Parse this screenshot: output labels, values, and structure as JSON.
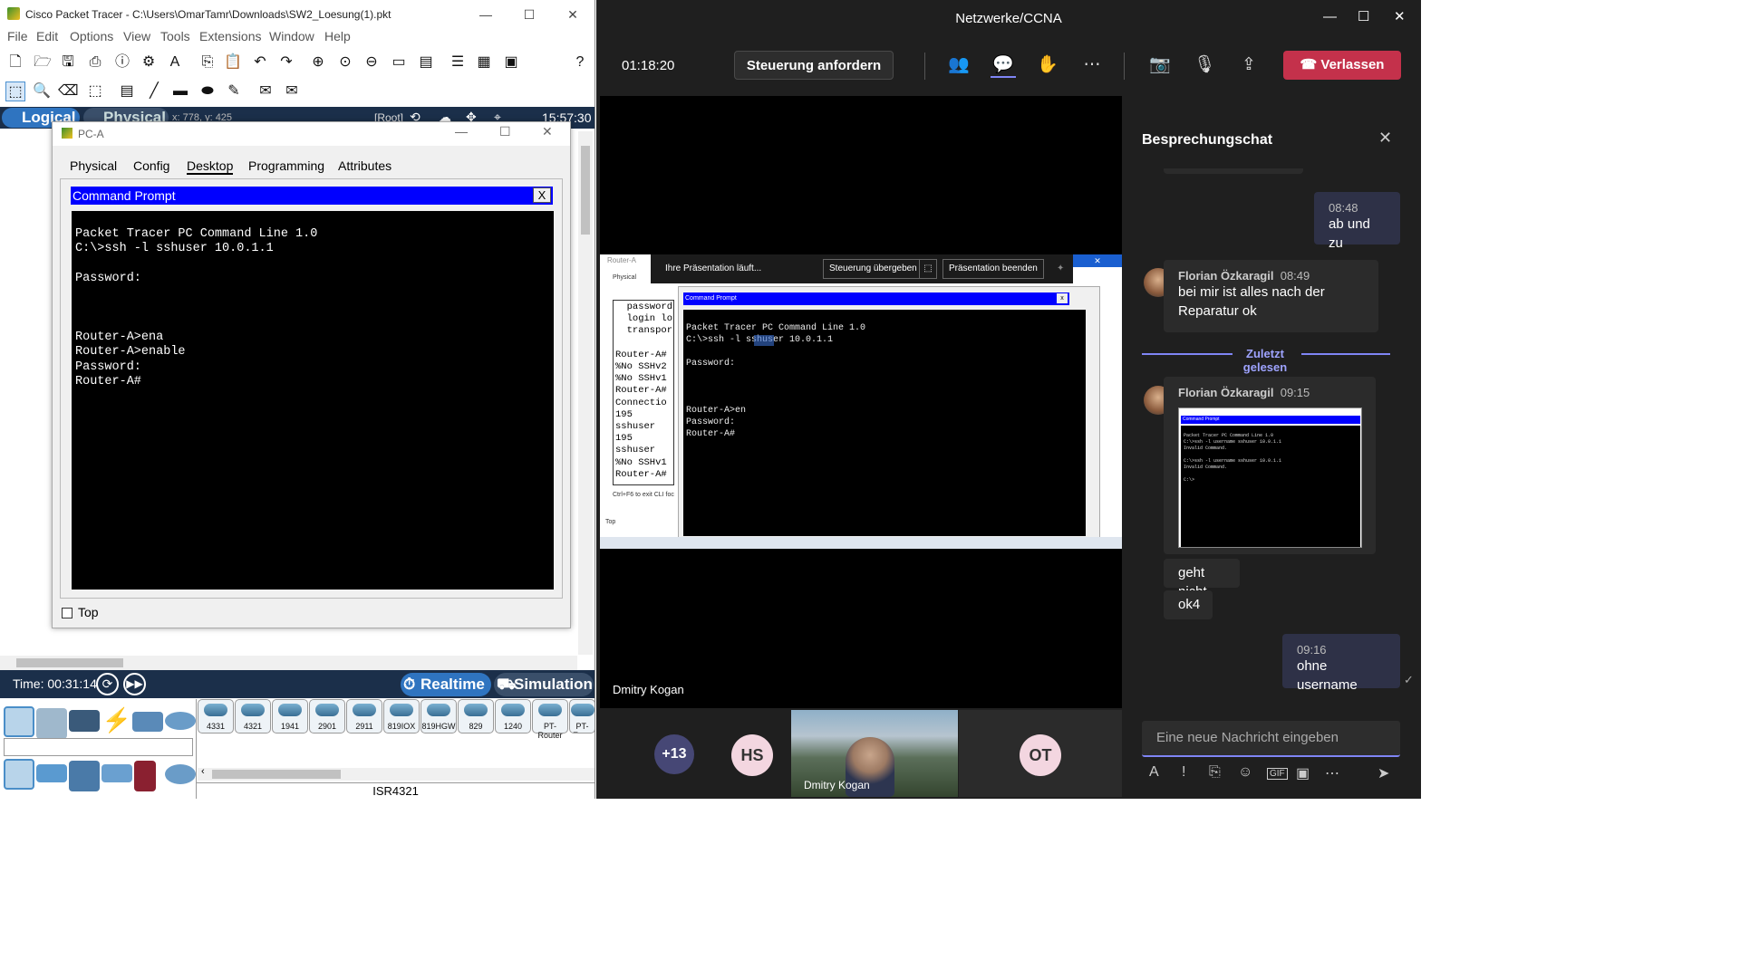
{
  "pt": {
    "title": "Cisco Packet Tracer - C:\\Users\\OmarTamr\\Downloads\\SW2_Loesung(1).pkt",
    "menu": [
      "File",
      "Edit",
      "Options",
      "View",
      "Tools",
      "Extensions",
      "Window",
      "Help"
    ],
    "mode_logical": "Logical",
    "mode_physical": "Physical",
    "coords": "x: 778, y: 425",
    "root": "[Root]",
    "clock": "15:57:30",
    "pc_window": {
      "title": "PC-A",
      "tabs": [
        "Physical",
        "Config",
        "Desktop",
        "Programming",
        "Attributes"
      ],
      "active_tab": "Desktop",
      "cmd_title": "Command Prompt",
      "cmd_close": "X",
      "terminal": "Packet Tracer PC Command Line 1.0\nC:\\>ssh -l sshuser 10.0.1.1\n\nPassword:\n\n\n\nRouter-A>ena\nRouter-A>enable\nPassword:\nRouter-A#",
      "top_label": "Top"
    },
    "time_label": "Time: 00:31:14",
    "realtime": "Realtime",
    "simulation": "Simulation",
    "models": [
      "4331",
      "4321",
      "1941",
      "2901",
      "2911",
      "819IOX",
      "819HGW",
      "829",
      "1240",
      "PT-Router",
      "PT-Empt"
    ],
    "selected_model": "ISR4321"
  },
  "teams": {
    "title": "Netzwerke/CCNA",
    "timer": "01:18:20",
    "request_control": "Steuerung anfordern",
    "leave": "Verlassen",
    "presenter_name": "Dmitry Kogan",
    "shared": {
      "presenting": "Ihre Präsentation läuft...",
      "give_control": "Steuerung übergeben",
      "stop": "Präsentation beenden",
      "cmd_title": "Command Prompt",
      "terminal": "Packet Tracer PC Command Line 1.0\nC:\\>ssh -l sshuser 10.0.1.1\n\nPassword:\n\n\n\nRouter-A>en\nPassword:\nRouter-A#",
      "router_title": "Router-A",
      "router_lines": "  password\n  login lo\n  transpor\n\nRouter-A#\n%No SSHv2\n%No SSHv1\nRouter-A#\nConnectio\n195\nsshuser\n195\nsshuser\n%No SSHv1\nRouter-A#",
      "ctrl_hint": "Ctrl+F6 to exit CLI foc",
      "top": "Top"
    },
    "participants": {
      "more": "+13",
      "hs": "HS",
      "ot": "OT",
      "video_name": "Dmitry Kogan"
    },
    "chat": {
      "title": "Besprechungschat",
      "messages": [
        {
          "time": "08:48",
          "text": "ab und zu"
        },
        {
          "author": "Florian Özkaragil",
          "time": "08:49",
          "text": "bei mir ist alles nach der Reparatur ok"
        },
        {
          "divider": "Zuletzt gelesen"
        },
        {
          "author": "Florian Özkaragil",
          "time": "09:15"
        },
        {
          "text": "geht nicht"
        },
        {
          "text": "ok4"
        },
        {
          "time": "09:16",
          "text": "ohne username"
        }
      ],
      "thumb_cmd": "Command Prompt",
      "thumb_terminal": "Packet Tracer PC Command Line 1.0\nC:\\>ssh -l username sshuser 10.0.1.1\nInvalid Command.\n\nC:\\>ssh -l username sshuser 10.0.1.1\nInvalid Command.\n\nC:\\>",
      "placeholder": "Eine neue Nachricht eingeben"
    }
  }
}
